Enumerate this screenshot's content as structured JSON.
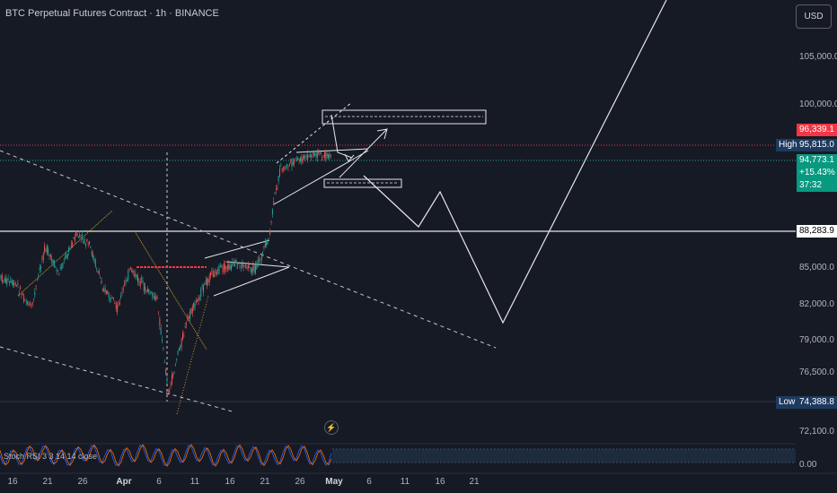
{
  "header": {
    "symbol_title": "BTC Perpetual Futures Contract · 1h · BINANCE",
    "currency_button": "USD"
  },
  "price_axis": {
    "ticks": [
      "105,000.0",
      "100,000.0",
      "85,000.0",
      "82,000.0",
      "79,000.0",
      "76,500.0",
      "72,100.0",
      "0.00"
    ]
  },
  "price_tags": {
    "upper_level": "96,339.1",
    "high_label": "High",
    "high_value": "95,815.0",
    "last_price": "94,773.1",
    "change_pct": "+15.43%",
    "countdown": "37:32",
    "horizontal_line": "88,283.9",
    "low_label": "Low",
    "low_value": "74,388.8"
  },
  "time_axis": {
    "labels": [
      "16",
      "21",
      "26",
      "Apr",
      "6",
      "11",
      "16",
      "21",
      "26",
      "May",
      "6",
      "11",
      "16",
      "21"
    ],
    "bold_labels": [
      "Apr",
      "May"
    ]
  },
  "indicator": {
    "label": "Stoch RSI 3 3 14 14 close",
    "value": "0.00"
  },
  "colors": {
    "background": "#161a25",
    "bull": "#26a69a",
    "bear": "#ef5350",
    "drawing": "#e6e6e6",
    "high_tag": "#1e3a5f",
    "last_tag": "#089981",
    "upper_tag": "#f23645",
    "marker": "#f23645"
  }
}
